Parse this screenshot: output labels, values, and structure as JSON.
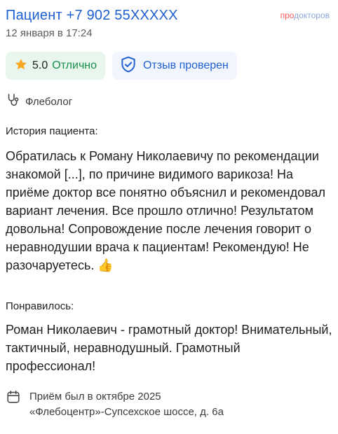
{
  "header": {
    "title": "Пациент +7 902 55XXXXX",
    "date": "12 января в 17:24",
    "brand_pro": "про",
    "brand_rest": "докторов"
  },
  "rating": {
    "score": "5.0",
    "label": "Отлично",
    "icon": "star-icon",
    "star_color": "#f5a623"
  },
  "verified": {
    "label": "Отзыв проверен",
    "icon": "shield-check-icon"
  },
  "specialty": {
    "label": "Флеболог",
    "icon": "stethoscope-icon"
  },
  "history": {
    "title": "История пациента:",
    "text": "Обратилась к Роману Николаевичу по рекомендации знакомой [...], по причине видимого варикоза! На приёме доктор все понятно объяснил и рекомендовал вариант лечения. Все прошло отлично! Результатом довольна! Сопровождение после лечения говорит о неравнодушии врача к пациентам! Рекомендую! Не разочаруетесь.",
    "emoji": "👍"
  },
  "liked": {
    "title": "Понравилось:",
    "text": "Роман Николаевич - грамотный доктор! Внимательный, тактичный, неравнодушный. Грамотный профессионал!"
  },
  "visit": {
    "icon": "calendar-icon",
    "date_line": "Приём был в октябре 2025",
    "clinic_line": "«Флебоцентр»-Супсехское шоссе, д. 6а"
  },
  "colors": {
    "link_blue": "#1f5fd1",
    "green": "#1a8f49",
    "rating_bg": "#e9f6ee",
    "verified_bg": "#f1f5fd"
  }
}
